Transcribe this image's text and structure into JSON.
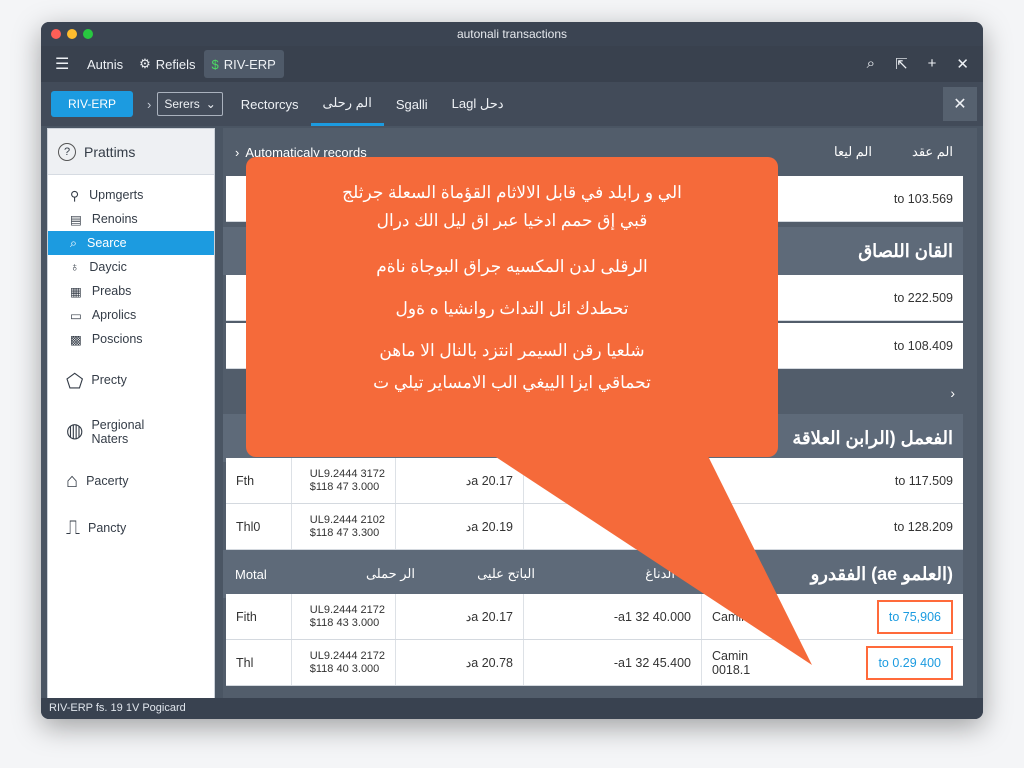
{
  "window": {
    "title": "autonali transactions"
  },
  "menubar": {
    "items": [
      {
        "label": "Autnis",
        "icon": "none"
      },
      {
        "label": "Refiels",
        "icon": "gear-icon"
      },
      {
        "label": "RIV-ERP",
        "icon": "dollar-icon"
      }
    ],
    "icons": [
      "search-icon",
      "export-icon",
      "plus-icon",
      "close-icon"
    ]
  },
  "toolbar": {
    "primary_button": "RIV-ERP",
    "select_value": "Serers",
    "tabs": [
      "Rectorcys",
      "الم رحلی",
      "Sgalli",
      "Lagl دحل"
    ],
    "active_tab": 1
  },
  "sidebar": {
    "header": "Prattims",
    "items": [
      {
        "label": "Upmgerts",
        "icon": "link-icon"
      },
      {
        "label": "Renoins",
        "icon": "document-icon"
      },
      {
        "label": "Searce",
        "icon": "search-icon",
        "active": true
      },
      {
        "label": "Daycic",
        "icon": "pin-icon"
      },
      {
        "label": "Preabs",
        "icon": "calendar-icon"
      },
      {
        "label": "Aprolics",
        "icon": "monitor-icon"
      },
      {
        "label": "Poscions",
        "icon": "grid-icon"
      }
    ],
    "big_items": [
      {
        "label": "Precty",
        "icon": "alert-icon"
      },
      {
        "label": "Pergional Naters",
        "icon": "globe-icon"
      },
      {
        "label": "Pacerty",
        "icon": "home-icon"
      },
      {
        "label": "Pancty",
        "icon": "chart-icon"
      }
    ]
  },
  "content": {
    "header": "Automaticaly records",
    "header_right": [
      "الم ليعا",
      "الم عقد"
    ],
    "sections": [
      {
        "title": "القان اللصاق",
        "rows": [
          "to 103.569"
        ]
      },
      {
        "title": "",
        "rows": [
          "to 222.509",
          "to 108.409"
        ]
      },
      {
        "title": "الفعمل (الرابن العلاقة",
        "rows": [
          "to 117.509",
          "to 128.209"
        ]
      },
      {
        "title": "الفقدرو (ae العلمو)",
        "rows": []
      }
    ],
    "table_rows_1": [
      {
        "c1": "Fth",
        "c2": "UL9.2444 3172\n$118 47 3.000",
        "c3": "دa 20.17",
        "amount": "to 117.509"
      },
      {
        "c1": "Thl0",
        "c2": "UL9.2444 2102\n$118 47 3.300",
        "c3": "دa 20.19",
        "amount": "to 128.209"
      }
    ],
    "table_head_2": [
      "Motal",
      "الر حملی",
      "الباتح عليی",
      "الدناغ"
    ],
    "table_rows_2": [
      {
        "c1": "Fith",
        "c2": "UL9.2444 2172\n$118 43 3.000",
        "c3": "دa 20.17",
        "c4": "-a1 32 40.000",
        "c5": "Camin",
        "amount": "to 75,906"
      },
      {
        "c1": "Thl",
        "c2": "UL9.2444 2172\n$118 40 3.000",
        "c3": "دa 20.78",
        "c4": "-a1 32 45.400",
        "c5": "Camin 0018.1",
        "amount": "to 0.29 400"
      }
    ]
  },
  "callout": {
    "lines": [
      "الي و رابلد في قابل الالاثام القؤماة السعلة جرثلج",
      "قبي إق حمم ادخيا عبر اق ليل الك درال",
      "الرقلى لدن المكسيه جراق البوجاة ناةم",
      "تحطدك ائل التداث روانشيا ه ةول",
      "شلعيا رقن السيمر انتزد بالنال الا ماهن",
      "تحماقي ايزا الييغي الب الامساير تيلي ت"
    ]
  },
  "status": {
    "text": "RIV-ERP fs. 19 1V Pogicard"
  },
  "colors": {
    "accent": "#1c9be0",
    "callout": "#f56a3a",
    "highlight": "#ff6a3a"
  }
}
